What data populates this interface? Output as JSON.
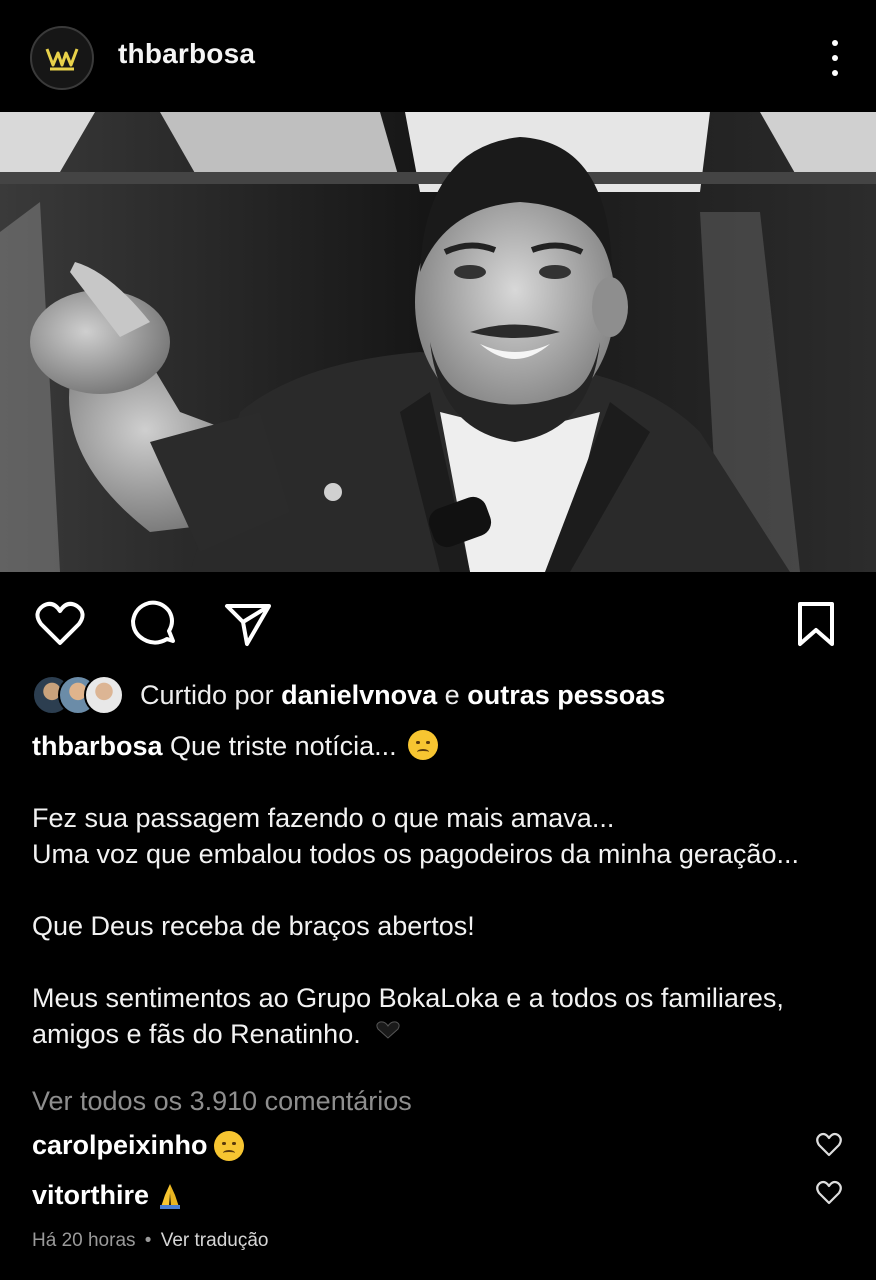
{
  "post": {
    "username": "thbarbosa",
    "avatar_icon": "crown-logo-icon",
    "brand_color": "#e8d14a"
  },
  "likes": {
    "prefix": "Curtido por",
    "user": "danielvnova",
    "joiner": "e",
    "others": "outras pessoas"
  },
  "caption": {
    "username": "thbarbosa",
    "first_line": "Que triste notícia...",
    "line2": "Fez sua passagem fazendo o que mais amava...",
    "line3": "Uma voz que embalou todos os pagodeiros da minha geração...",
    "line4": "Que Deus receba de braços abertos!",
    "line5": "Meus sentimentos ao Grupo BokaLoka e a todos os familiares,",
    "line6": "amigos e fãs do Renatinho."
  },
  "comments_link": "Ver todos os 3.910 comentários",
  "comments": [
    {
      "user": "carolpeixinho",
      "emoji": "pensive-face-emoji"
    },
    {
      "user": "vitorthire",
      "emoji": "folded-hands-emoji"
    }
  ],
  "meta": {
    "time": "Há 20 horas",
    "separator": "•",
    "translate": "Ver tradução"
  }
}
